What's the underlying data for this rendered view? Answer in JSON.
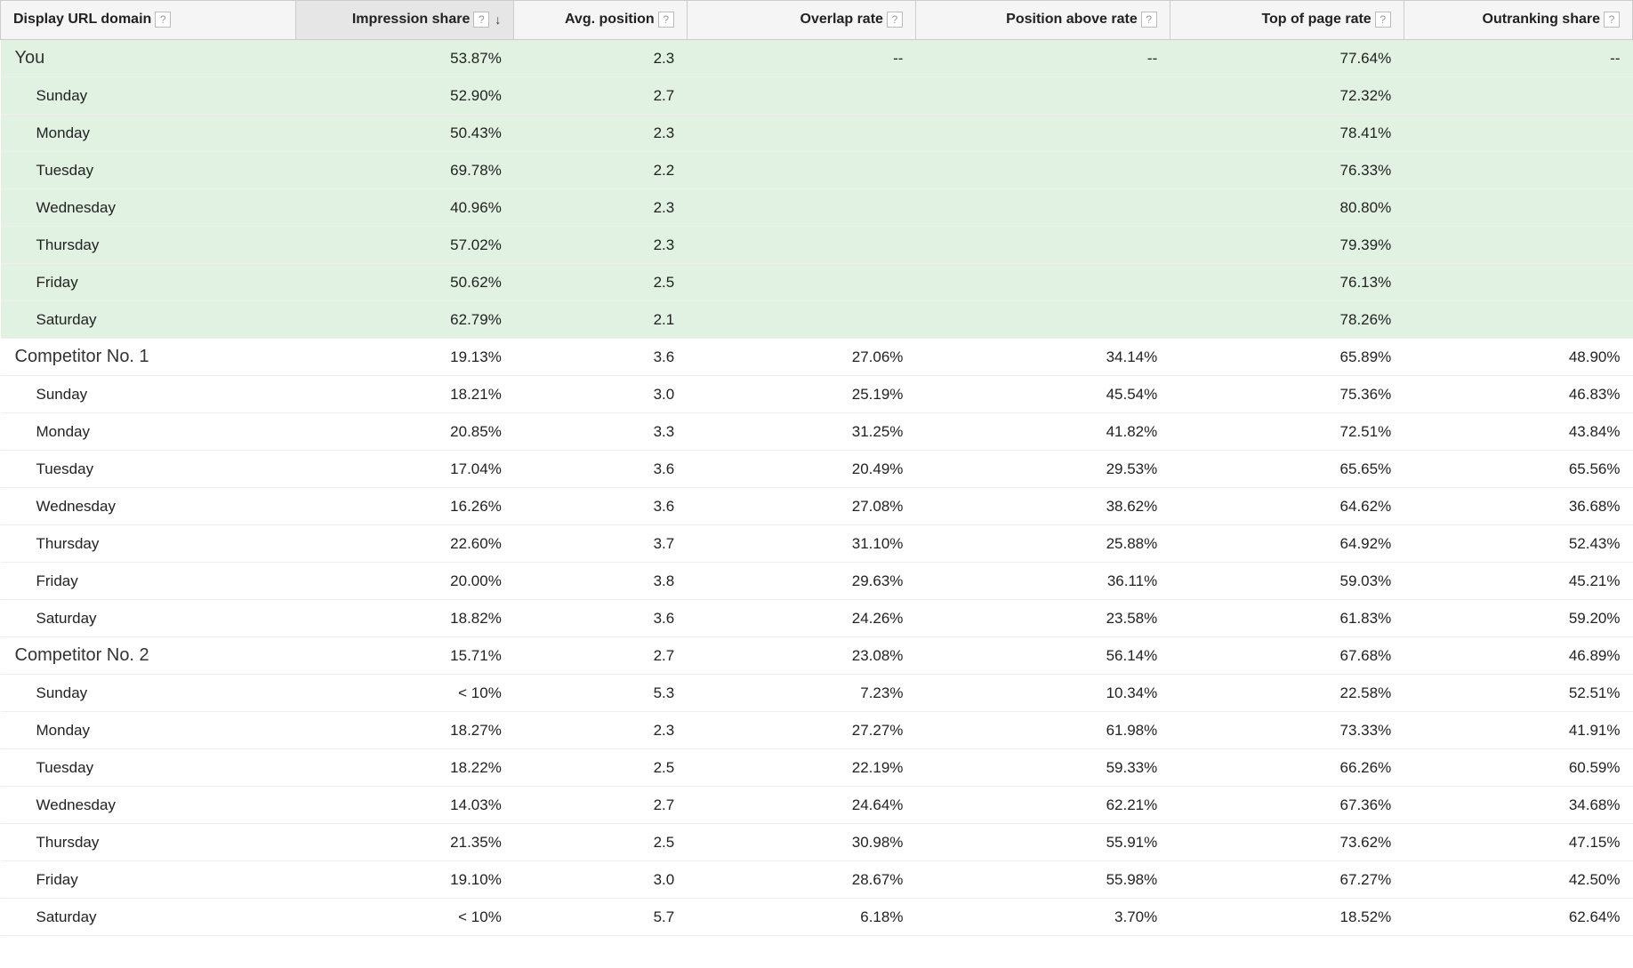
{
  "columns": [
    {
      "label": "Display URL domain",
      "help": "?",
      "sorted": false
    },
    {
      "label": "Impression share",
      "help": "?",
      "sorted": true
    },
    {
      "label": "Avg. position",
      "help": "?",
      "sorted": false
    },
    {
      "label": "Overlap rate",
      "help": "?",
      "sorted": false
    },
    {
      "label": "Position above rate",
      "help": "?",
      "sorted": false
    },
    {
      "label": "Top of page rate",
      "help": "?",
      "sorted": false
    },
    {
      "label": "Outranking share",
      "help": "?",
      "sorted": false
    }
  ],
  "sort_arrow_glyph": "↓",
  "groups": [
    {
      "label": "You",
      "highlight": true,
      "summary": {
        "impression_share": "53.87%",
        "avg_position": "2.3",
        "overlap_rate": "--",
        "position_above_rate": "--",
        "top_of_page_rate": "77.64%",
        "outranking_share": "--"
      },
      "children": [
        {
          "label": "Sunday",
          "impression_share": "52.90%",
          "avg_position": "2.7",
          "overlap_rate": "",
          "position_above_rate": "",
          "top_of_page_rate": "72.32%",
          "outranking_share": ""
        },
        {
          "label": "Monday",
          "impression_share": "50.43%",
          "avg_position": "2.3",
          "overlap_rate": "",
          "position_above_rate": "",
          "top_of_page_rate": "78.41%",
          "outranking_share": ""
        },
        {
          "label": "Tuesday",
          "impression_share": "69.78%",
          "avg_position": "2.2",
          "overlap_rate": "",
          "position_above_rate": "",
          "top_of_page_rate": "76.33%",
          "outranking_share": ""
        },
        {
          "label": "Wednesday",
          "impression_share": "40.96%",
          "avg_position": "2.3",
          "overlap_rate": "",
          "position_above_rate": "",
          "top_of_page_rate": "80.80%",
          "outranking_share": ""
        },
        {
          "label": "Thursday",
          "impression_share": "57.02%",
          "avg_position": "2.3",
          "overlap_rate": "",
          "position_above_rate": "",
          "top_of_page_rate": "79.39%",
          "outranking_share": ""
        },
        {
          "label": "Friday",
          "impression_share": "50.62%",
          "avg_position": "2.5",
          "overlap_rate": "",
          "position_above_rate": "",
          "top_of_page_rate": "76.13%",
          "outranking_share": ""
        },
        {
          "label": "Saturday",
          "impression_share": "62.79%",
          "avg_position": "2.1",
          "overlap_rate": "",
          "position_above_rate": "",
          "top_of_page_rate": "78.26%",
          "outranking_share": ""
        }
      ]
    },
    {
      "label": "Competitor No. 1",
      "highlight": false,
      "summary": {
        "impression_share": "19.13%",
        "avg_position": "3.6",
        "overlap_rate": "27.06%",
        "position_above_rate": "34.14%",
        "top_of_page_rate": "65.89%",
        "outranking_share": "48.90%"
      },
      "children": [
        {
          "label": "Sunday",
          "impression_share": "18.21%",
          "avg_position": "3.0",
          "overlap_rate": "25.19%",
          "position_above_rate": "45.54%",
          "top_of_page_rate": "75.36%",
          "outranking_share": "46.83%"
        },
        {
          "label": "Monday",
          "impression_share": "20.85%",
          "avg_position": "3.3",
          "overlap_rate": "31.25%",
          "position_above_rate": "41.82%",
          "top_of_page_rate": "72.51%",
          "outranking_share": "43.84%"
        },
        {
          "label": "Tuesday",
          "impression_share": "17.04%",
          "avg_position": "3.6",
          "overlap_rate": "20.49%",
          "position_above_rate": "29.53%",
          "top_of_page_rate": "65.65%",
          "outranking_share": "65.56%"
        },
        {
          "label": "Wednesday",
          "impression_share": "16.26%",
          "avg_position": "3.6",
          "overlap_rate": "27.08%",
          "position_above_rate": "38.62%",
          "top_of_page_rate": "64.62%",
          "outranking_share": "36.68%"
        },
        {
          "label": "Thursday",
          "impression_share": "22.60%",
          "avg_position": "3.7",
          "overlap_rate": "31.10%",
          "position_above_rate": "25.88%",
          "top_of_page_rate": "64.92%",
          "outranking_share": "52.43%"
        },
        {
          "label": "Friday",
          "impression_share": "20.00%",
          "avg_position": "3.8",
          "overlap_rate": "29.63%",
          "position_above_rate": "36.11%",
          "top_of_page_rate": "59.03%",
          "outranking_share": "45.21%"
        },
        {
          "label": "Saturday",
          "impression_share": "18.82%",
          "avg_position": "3.6",
          "overlap_rate": "24.26%",
          "position_above_rate": "23.58%",
          "top_of_page_rate": "61.83%",
          "outranking_share": "59.20%"
        }
      ]
    },
    {
      "label": "Competitor No. 2",
      "highlight": false,
      "summary": {
        "impression_share": "15.71%",
        "avg_position": "2.7",
        "overlap_rate": "23.08%",
        "position_above_rate": "56.14%",
        "top_of_page_rate": "67.68%",
        "outranking_share": "46.89%"
      },
      "children": [
        {
          "label": "Sunday",
          "impression_share": "< 10%",
          "avg_position": "5.3",
          "overlap_rate": "7.23%",
          "position_above_rate": "10.34%",
          "top_of_page_rate": "22.58%",
          "outranking_share": "52.51%"
        },
        {
          "label": "Monday",
          "impression_share": "18.27%",
          "avg_position": "2.3",
          "overlap_rate": "27.27%",
          "position_above_rate": "61.98%",
          "top_of_page_rate": "73.33%",
          "outranking_share": "41.91%"
        },
        {
          "label": "Tuesday",
          "impression_share": "18.22%",
          "avg_position": "2.5",
          "overlap_rate": "22.19%",
          "position_above_rate": "59.33%",
          "top_of_page_rate": "66.26%",
          "outranking_share": "60.59%"
        },
        {
          "label": "Wednesday",
          "impression_share": "14.03%",
          "avg_position": "2.7",
          "overlap_rate": "24.64%",
          "position_above_rate": "62.21%",
          "top_of_page_rate": "67.36%",
          "outranking_share": "34.68%"
        },
        {
          "label": "Thursday",
          "impression_share": "21.35%",
          "avg_position": "2.5",
          "overlap_rate": "30.98%",
          "position_above_rate": "55.91%",
          "top_of_page_rate": "73.62%",
          "outranking_share": "47.15%"
        },
        {
          "label": "Friday",
          "impression_share": "19.10%",
          "avg_position": "3.0",
          "overlap_rate": "28.67%",
          "position_above_rate": "55.98%",
          "top_of_page_rate": "67.27%",
          "outranking_share": "42.50%"
        },
        {
          "label": "Saturday",
          "impression_share": "< 10%",
          "avg_position": "5.7",
          "overlap_rate": "6.18%",
          "position_above_rate": "3.70%",
          "top_of_page_rate": "18.52%",
          "outranking_share": "62.64%"
        }
      ]
    }
  ]
}
